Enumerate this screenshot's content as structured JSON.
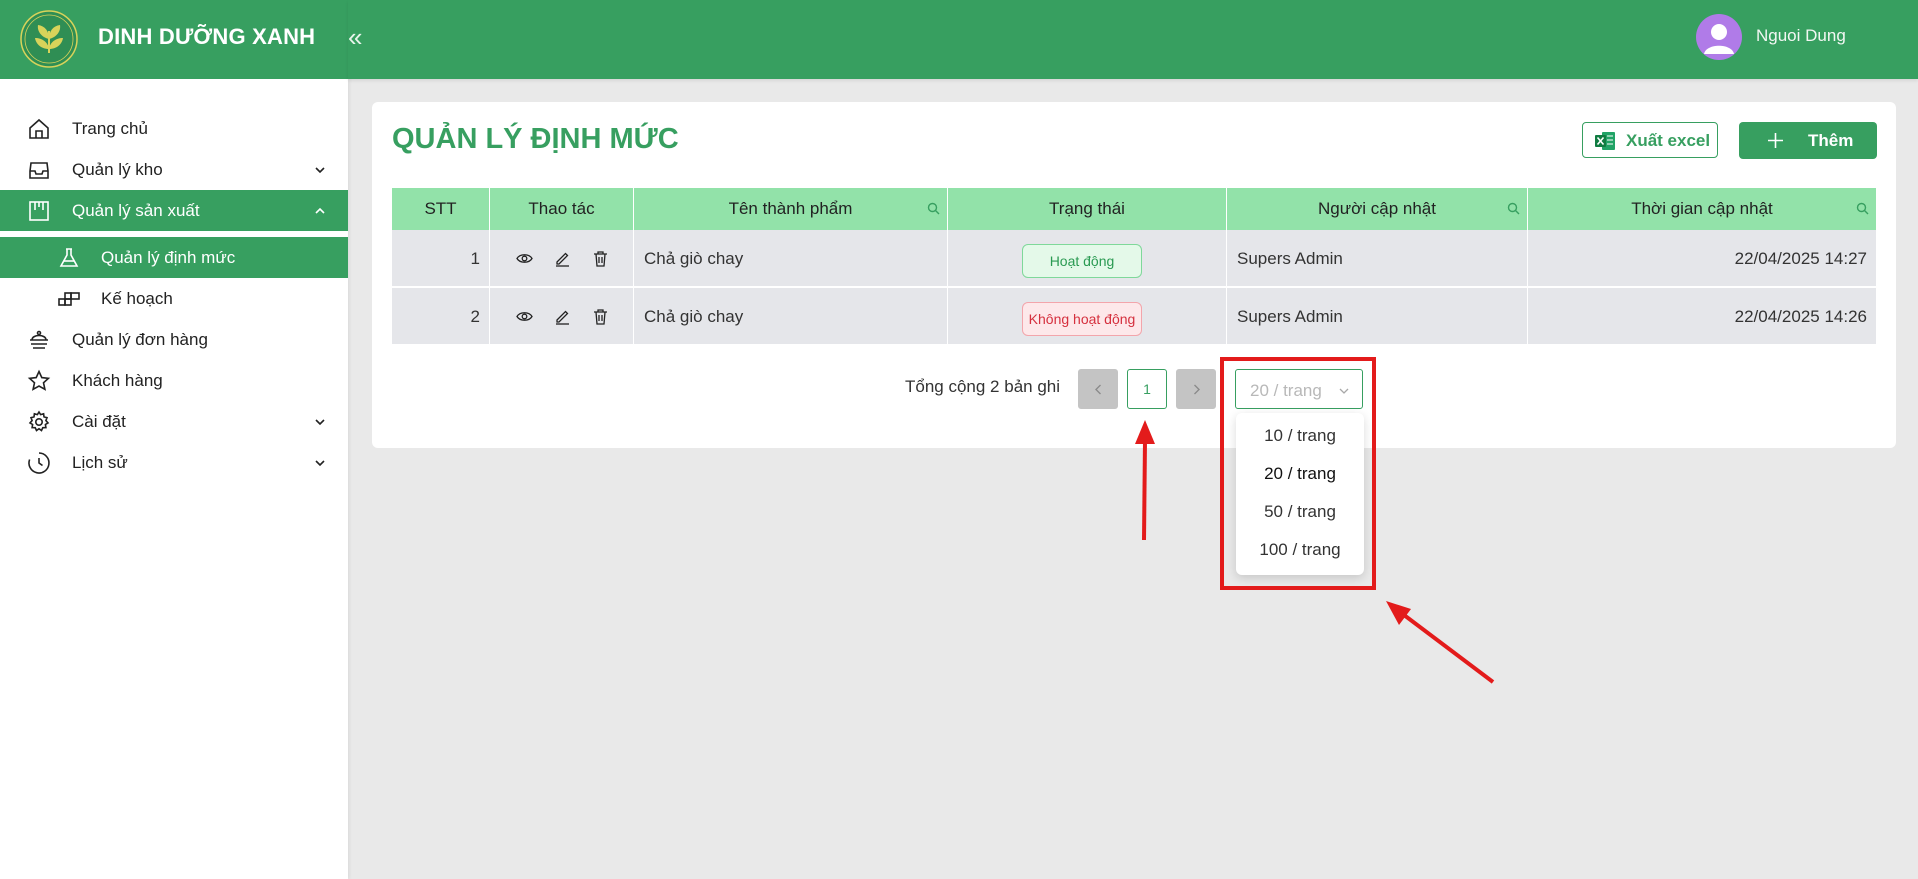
{
  "brand": {
    "name": "DINH DƯỠNG XANH",
    "logo_icon": "leaf-logo-icon"
  },
  "sidebar": {
    "collapse_icon": "double-chevron-left-icon",
    "collapse_glyph": "«",
    "items": [
      {
        "label": "Trang chủ",
        "icon": "home-icon"
      },
      {
        "label": "Quản lý kho",
        "icon": "inbox-icon"
      },
      {
        "label": "Quản lý sản xuất",
        "icon": "production-board-icon"
      },
      {
        "label": "Quản lý định mức",
        "icon": "flask-icon"
      },
      {
        "label": "Kế hoạch",
        "icon": "plan-blocks-icon"
      },
      {
        "label": "Quản lý đơn hàng",
        "icon": "order-icon"
      },
      {
        "label": "Khách hàng",
        "icon": "star-icon"
      },
      {
        "label": "Cài đặt",
        "icon": "gear-icon"
      },
      {
        "label": "Lịch sử",
        "icon": "history-clock-icon"
      }
    ]
  },
  "header": {
    "user_name": "Nguoi Dung",
    "avatar_icon": "user-avatar-icon"
  },
  "page": {
    "title": "QUẢN LÝ ĐỊNH MỨC",
    "export_label": "Xuất excel",
    "add_label": "Thêm"
  },
  "table": {
    "columns": [
      "STT",
      "Thao tác",
      "Tên thành phẩm",
      "Trạng thái",
      "Người cập nhật",
      "Thời gian cập nhật"
    ],
    "rows": [
      {
        "stt": "1",
        "name": "Chả giò chay",
        "status": "Hoạt động",
        "updated_by": "Supers Admin",
        "updated_at": "22/04/2025 14:27"
      },
      {
        "stt": "2",
        "name": "Chả giò chay",
        "status": "Không hoạt động",
        "updated_by": "Supers Admin",
        "updated_at": "22/04/2025 14:26"
      }
    ]
  },
  "pagination": {
    "total_text": "Tổng cộng 2 bản ghi",
    "current_page": "1",
    "page_size": "20 / trang",
    "options": [
      "10 / trang",
      "20 / trang",
      "50 / trang",
      "100 / trang"
    ]
  },
  "colors": {
    "primary": "#379f60",
    "header_row": "#92e2a9",
    "row_bg": "#e5e6ea",
    "active_badge": "#2a9a52",
    "inactive_badge": "#d5303e",
    "annotation": "#e31b1b"
  }
}
